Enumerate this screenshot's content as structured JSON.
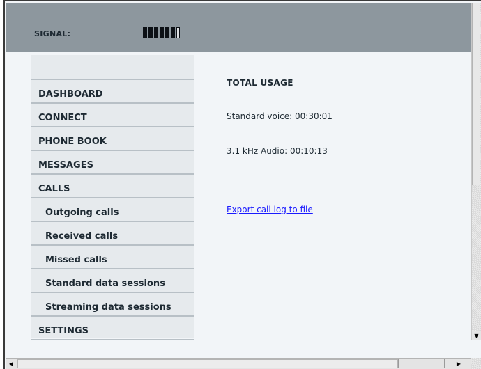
{
  "header": {
    "signal_label": "SIGNAL:",
    "signal_bars_filled": 6,
    "signal_bars_total": 7
  },
  "sidebar": {
    "items": [
      {
        "label": "DASHBOARD",
        "sub": false
      },
      {
        "label": "CONNECT",
        "sub": false
      },
      {
        "label": "PHONE BOOK",
        "sub": false
      },
      {
        "label": "MESSAGES",
        "sub": false
      },
      {
        "label": "CALLS",
        "sub": false
      },
      {
        "label": "Outgoing calls",
        "sub": true
      },
      {
        "label": "Received calls",
        "sub": true
      },
      {
        "label": "Missed calls",
        "sub": true
      },
      {
        "label": "Standard data sessions",
        "sub": true
      },
      {
        "label": "Streaming data sessions",
        "sub": true
      },
      {
        "label": "SETTINGS",
        "sub": false
      }
    ]
  },
  "main": {
    "title": "TOTAL USAGE",
    "usage": [
      "Standard voice: 00:30:01",
      "3.1 kHz Audio: 00:10:13"
    ],
    "export_link": "Export call log to file"
  },
  "colors": {
    "header_bg": "#8d979e",
    "sidebar_bg": "#e6eaed",
    "content_bg": "#f2f5f8",
    "link": "#1a1aff"
  },
  "icons": {
    "scroll_down": "triangle-down",
    "scroll_left": "triangle-left",
    "scroll_right": "triangle-right"
  }
}
